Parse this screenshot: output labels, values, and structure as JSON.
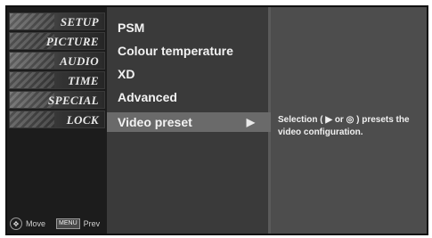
{
  "categories": [
    {
      "label": "SETUP"
    },
    {
      "label": "PICTURE"
    },
    {
      "label": "AUDIO"
    },
    {
      "label": "TIME"
    },
    {
      "label": "SPECIAL"
    },
    {
      "label": "LOCK"
    }
  ],
  "hint": {
    "move_icon": "dpad-icon",
    "move_label": "Move",
    "prev_key": "MENU",
    "prev_label": "Prev"
  },
  "menu": {
    "items": [
      {
        "label": "PSM"
      },
      {
        "label": "Colour temperature"
      },
      {
        "label": "XD"
      },
      {
        "label": "Advanced"
      },
      {
        "label": "Video preset"
      }
    ],
    "selected_index": 4,
    "selected_arrow": "▶"
  },
  "info": {
    "text": "Selection ( ▶ or ◎ ) presets the video configuration."
  }
}
